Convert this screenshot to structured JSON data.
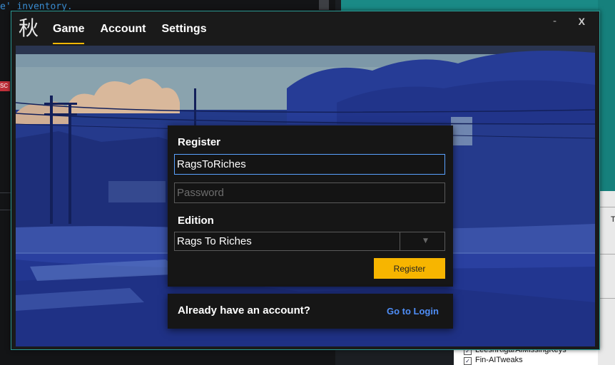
{
  "background": {
    "code_text": "e' inventory.",
    "badge_text": "SC",
    "right_col_letter": "T",
    "plugin_list": [
      {
        "label": "LeeshRigarAiMissingKeys",
        "checked": true
      },
      {
        "label": "Fin-AITweaks",
        "checked": true
      }
    ]
  },
  "window": {
    "logo_glyph": "秋",
    "nav": [
      "Game",
      "Account",
      "Settings"
    ],
    "active_nav": "Game",
    "minimize_label": "-",
    "close_label": "X",
    "accent_color": "#f2b705"
  },
  "register": {
    "title": "Register",
    "username_value": "RagsToRiches",
    "password_placeholder": "Password",
    "edition_label": "Edition",
    "edition_value": "Rags To Riches",
    "button_label": "Register",
    "button_color": "#f7b500"
  },
  "login_prompt": {
    "text": "Already have an account?",
    "link_label": "Go to Login",
    "link_color": "#4f8ef7"
  }
}
